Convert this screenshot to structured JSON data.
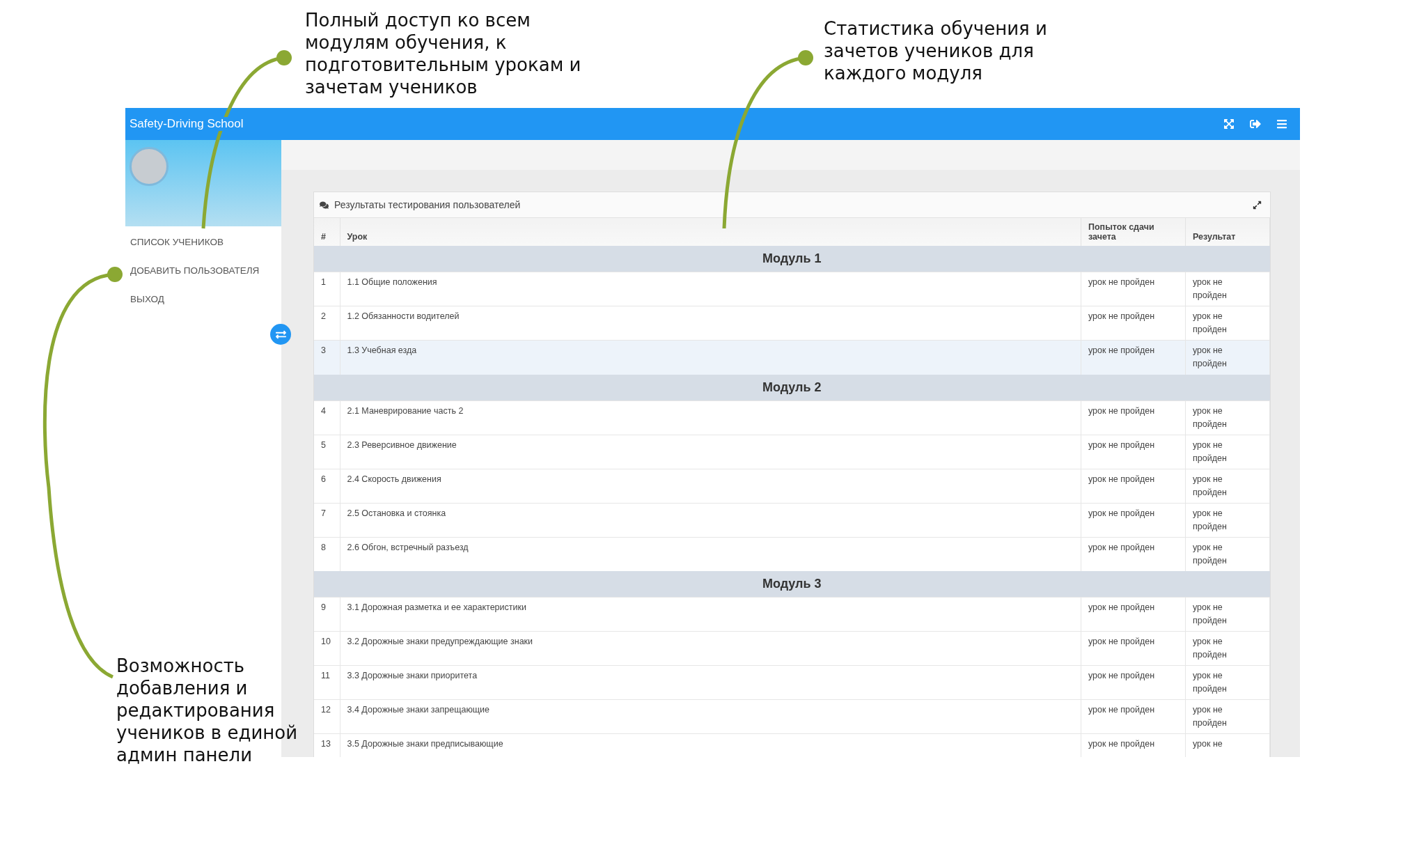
{
  "callouts": [
    {
      "text": "Полный доступ ко всем\nмодулям обучения, к\nподготовительным урокам и\nзачетам учеников"
    },
    {
      "text": "Статистика обучения и\nзачетов учеников для\nкаждого модуля"
    },
    {
      "text": "Возможность\nдобавления и\nредактирования\nучеников в единой\nадмин панели"
    }
  ],
  "app": {
    "title": "Safety-Driving School"
  },
  "sidebar": {
    "items": [
      {
        "label": "СПИСОК УЧЕНИКОВ"
      },
      {
        "label": "ДОБАВИТЬ ПОЛЬЗОВАТЕЛЯ"
      },
      {
        "label": "ВЫХОД"
      }
    ]
  },
  "panel": {
    "title": "Результаты тестирования пользователей"
  },
  "table": {
    "columns": [
      "#",
      "Урок",
      "Попыток сдачи зачета",
      "Результат"
    ],
    "modules": [
      {
        "title": "Модуль 1",
        "rows": [
          {
            "num": "1",
            "lesson": "1.1 Общие положения",
            "attempts": "урок не пройден",
            "result": "урок не пройден",
            "selected": false
          },
          {
            "num": "2",
            "lesson": "1.2 Обязанности водителей",
            "attempts": "урок не пройден",
            "result": "урок не пройден",
            "selected": false
          },
          {
            "num": "3",
            "lesson": "1.3 Учебная езда",
            "attempts": "урок не пройден",
            "result": "урок не пройден",
            "selected": true
          }
        ]
      },
      {
        "title": "Модуль 2",
        "rows": [
          {
            "num": "4",
            "lesson": "2.1 Маневрирование часть 2",
            "attempts": "урок не пройден",
            "result": "урок не пройден",
            "selected": false
          },
          {
            "num": "5",
            "lesson": "2.3 Реверсивное движение",
            "attempts": "урок не пройден",
            "result": "урок не пройден",
            "selected": false
          },
          {
            "num": "6",
            "lesson": "2.4 Скорость движения",
            "attempts": "урок не пройден",
            "result": "урок не пройден",
            "selected": false
          },
          {
            "num": "7",
            "lesson": "2.5 Остановка и стоянка",
            "attempts": "урок не пройден",
            "result": "урок не пройден",
            "selected": false
          },
          {
            "num": "8",
            "lesson": "2.6 Обгон, встречный разъезд",
            "attempts": "урок не пройден",
            "result": "урок не пройден",
            "selected": false
          }
        ]
      },
      {
        "title": "Модуль 3",
        "rows": [
          {
            "num": "9",
            "lesson": "3.1 Дорожная разметка и ее характеристики",
            "attempts": "урок не пройден",
            "result": "урок не пройден",
            "selected": false
          },
          {
            "num": "10",
            "lesson": "3.2 Дорожные знаки предупреждающие знаки",
            "attempts": "урок не пройден",
            "result": "урок не пройден",
            "selected": false
          },
          {
            "num": "11",
            "lesson": "3.3 Дорожные знаки приоритета",
            "attempts": "урок не пройден",
            "result": "урок не пройден",
            "selected": false
          },
          {
            "num": "12",
            "lesson": "3.4 Дорожные знаки запрещающие",
            "attempts": "урок не пройден",
            "result": "урок не пройден",
            "selected": false
          },
          {
            "num": "13",
            "lesson": "3.5 Дорожные знаки предписывающие",
            "attempts": "урок не пройден",
            "result": "урок не",
            "selected": false
          }
        ]
      }
    ]
  }
}
